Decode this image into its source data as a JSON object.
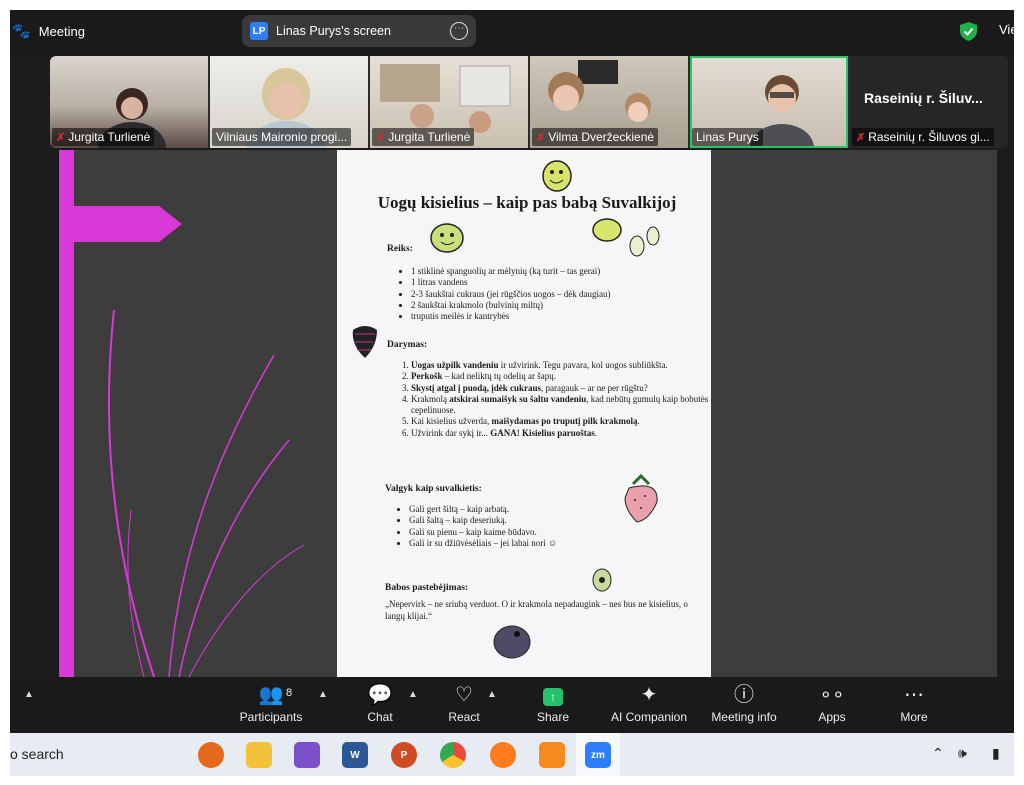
{
  "topbar": {
    "meeting_label": "Meeting",
    "screen_badge": "LP",
    "screen_title": "Linas Purys's screen",
    "view_label": "Vie"
  },
  "participants": [
    {
      "name": "Jurgita Turlienė",
      "muted": true
    },
    {
      "name": "Vilniaus Maironio progi...",
      "muted": false
    },
    {
      "name": "Jurgita Turlienė",
      "muted": true
    },
    {
      "name": "Vilma Dveržeckienė",
      "muted": true
    },
    {
      "name": "Linas Purys",
      "muted": false
    },
    {
      "name": "Raseinių r. Šiluvos gi...",
      "muted": true,
      "title": "Raseinių r. Šiluv..."
    }
  ],
  "document": {
    "title": "Uogų kisielius – kaip pas babą Suvalkijoj",
    "reiks_heading": "Reiks:",
    "ingredients": [
      "1 stiklinė spanguolių ar mėlynių (ką turit – tas gerai)",
      "1 litras vandens",
      "2-3 šaukštai cukraus (jei rūgščios uogos – dėk daugiau)",
      "2 šaukštai krakmolo (bulvinių miltų)",
      "truputis meilės ir kantrybės"
    ],
    "darymas_heading": "Darymas:",
    "steps": [
      {
        "bold": "Uogas užpilk vandeniu",
        "text": " ir užvirink. Tegu pavara, kol uogos subliūkšta."
      },
      {
        "bold": "Perkošk",
        "text": " – kad neliktų tų odelių ar šapų."
      },
      {
        "bold": "Skystį atgal į puodą, įdėk cukraus",
        "text": ", paragauk – ar ne per rūgštu?"
      },
      {
        "bold": "atskirai sumaišyk su šaltu vandeniu",
        "text": ", kad nebūtų gumulų kaip bobutės cepelinuose.",
        "prefix": "Krakmolą "
      },
      {
        "bold": "maišydamas po truputį pilk krakmolą",
        "text": ".",
        "prefix": "Kai kisielius užverda, "
      },
      {
        "bold": "GANA! Kisielius paruoštas",
        "text": ".",
        "prefix": "Užvirink dar sykį ir... "
      }
    ],
    "valgyk_heading": "Valgyk kaip suvalkietis:",
    "serving": [
      "Gali gert šiltą – kaip arbatą.",
      "Gali šaltą – kaip deseriuką.",
      "Gali su pienu – kaip kaime būdavo.",
      "Gali ir su džiūvėsėliais – jei labai nori ☺"
    ],
    "babos_heading": "Babos pastebėjimas:",
    "quote": "„Nepervirk – ne sriubą verduot. O ir krakmola nepadaugink – nes bus ne kisielius, o langų klijai.“"
  },
  "controls": {
    "participants_label": "Participants",
    "participants_count": "8",
    "chat_label": "Chat",
    "react_label": "React",
    "share_label": "Share",
    "ai_label": "AI Companion",
    "info_label": "Meeting info",
    "apps_label": "Apps",
    "more_label": "More"
  },
  "taskbar": {
    "search_text": "o search",
    "word_badge": "W",
    "ppt_badge": "P",
    "zoom_badge": "zm"
  },
  "colors": {
    "accent_magenta": "#d93ad7",
    "active_speaker": "#29c36a",
    "share_green": "#23c36b",
    "zoom_blue": "#2d7ff9"
  }
}
